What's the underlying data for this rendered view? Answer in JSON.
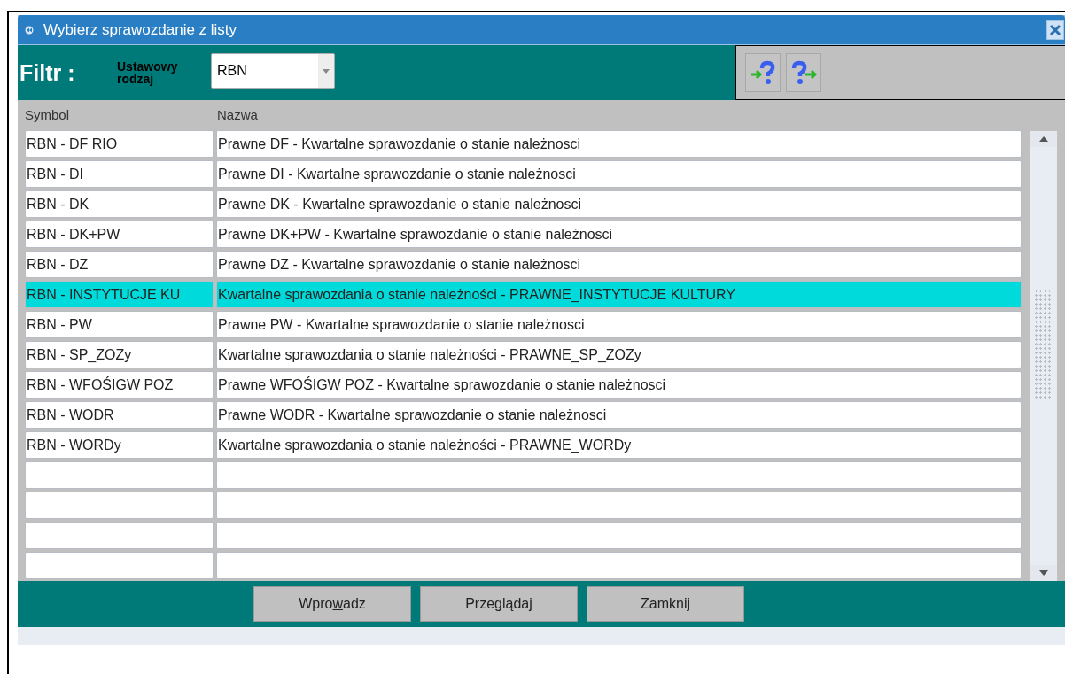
{
  "window": {
    "title": "Wybierz sprawozdanie z listy"
  },
  "filter": {
    "label": "Filtr :",
    "field_label": "Ustawowy rodzaj",
    "value": "RBN"
  },
  "table": {
    "columns": [
      "Symbol",
      "Nazwa"
    ],
    "rows": [
      {
        "symbol": "RBN - DF RIO",
        "name": "Prawne DF - Kwartalne sprawozdanie o stanie należnosci",
        "selected": false
      },
      {
        "symbol": "RBN - DI",
        "name": "Prawne DI - Kwartalne sprawozdanie o stanie należnosci",
        "selected": false
      },
      {
        "symbol": "RBN - DK",
        "name": "Prawne DK - Kwartalne sprawozdanie o stanie należnosci",
        "selected": false
      },
      {
        "symbol": "RBN - DK+PW",
        "name": "Prawne DK+PW - Kwartalne sprawozdanie o stanie należnosci",
        "selected": false
      },
      {
        "symbol": "RBN - DZ",
        "name": "Prawne DZ - Kwartalne sprawozdanie o stanie należnosci",
        "selected": false
      },
      {
        "symbol": "RBN - INSTYTUCJE KU",
        "name": "Kwartalne sprawozdania o stanie należności - PRAWNE_INSTYTUCJE KULTURY",
        "selected": true
      },
      {
        "symbol": "RBN - PW",
        "name": "Prawne PW - Kwartalne sprawozdanie o stanie należnosci",
        "selected": false
      },
      {
        "symbol": "RBN - SP_ZOZy",
        "name": "Kwartalne sprawozdania o stanie należności - PRAWNE_SP_ZOZy",
        "selected": false
      },
      {
        "symbol": "RBN - WFOŚIGW POZ",
        "name": "Prawne WFOŚIGW POZ - Kwartalne sprawozdanie o stanie należnosci",
        "selected": false
      },
      {
        "symbol": "RBN - WODR",
        "name": "Prawne WODR - Kwartalne sprawozdanie o stanie należnosci",
        "selected": false
      },
      {
        "symbol": "RBN - WORDy",
        "name": "Kwartalne sprawozdania o stanie należności - PRAWNE_WORDy",
        "selected": false
      }
    ]
  },
  "buttons": [
    {
      "before": "Wpro",
      "access_key": "w",
      "after": "adz"
    },
    {
      "before": "Przeglądaj"
    },
    {
      "before": "Zamknij"
    }
  ]
}
